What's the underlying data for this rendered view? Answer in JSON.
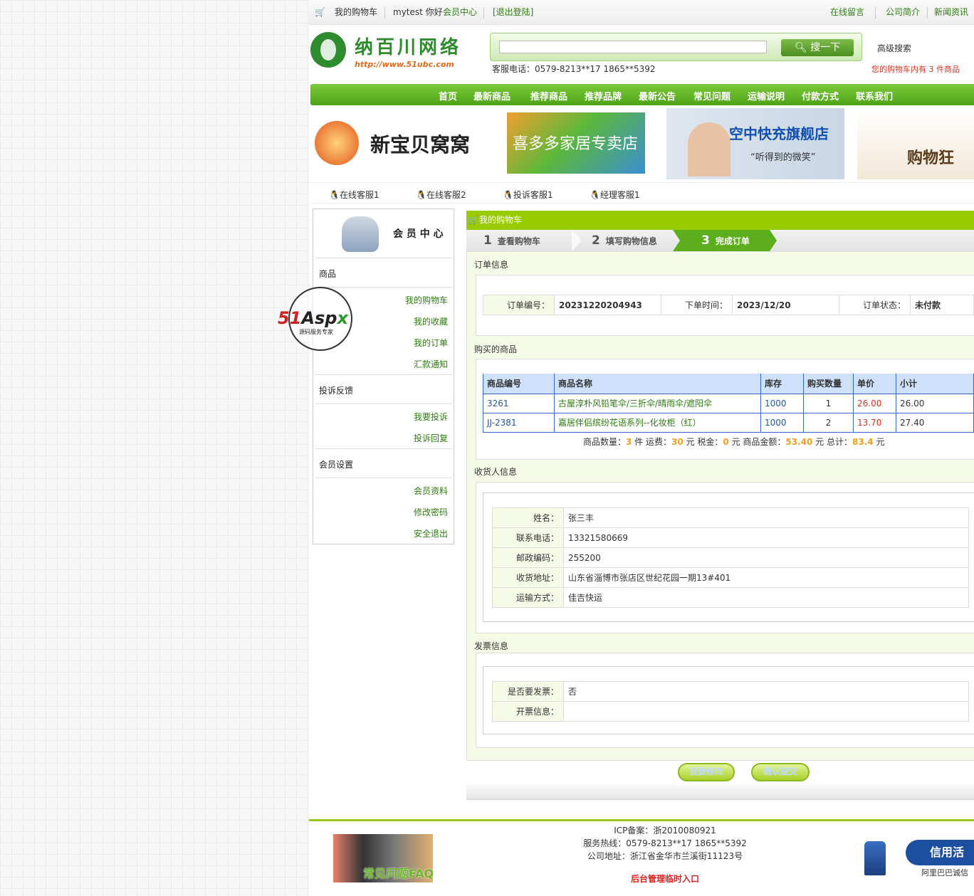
{
  "topbar": {
    "cart": "我的购物车",
    "user": "mytest 你好",
    "member": "会员中心",
    "logout": "[退出登陆]",
    "links": [
      "在线留言",
      "公司简介",
      "新闻资讯"
    ]
  },
  "header": {
    "logo_text": "纳百川网络",
    "logo_url": "http://www.51ubc.com",
    "search_placeholder": "",
    "search_button": "搜一下",
    "advanced": "高级搜索",
    "phone": "客服电话：0579-8213**17 1865**5392",
    "cart_info": "您的购物车内有 3  件商品"
  },
  "nav": [
    "首页",
    "最新商品",
    "推荐商品",
    "推荐品牌",
    "最新公告",
    "常见问题",
    "运输说明",
    "付款方式",
    "联系我们"
  ],
  "banners": [
    "新宝贝窝窝",
    "喜多多家居专卖店",
    "空中快充旗舰店",
    "“听得到的微笑”",
    "购物狂"
  ],
  "service": [
    "在线客服1",
    "在线客服2",
    "投诉客服1",
    "经理客服1"
  ],
  "sidebar": {
    "title": "会 员 中 心",
    "groups": [
      {
        "label": "商品",
        "items": [
          "我的购物车",
          "我的收藏",
          "我的订单",
          "汇款通知"
        ]
      },
      {
        "label": "投诉反馈",
        "items": [
          "我要投诉",
          "投诉回复"
        ]
      },
      {
        "label": "会员设置",
        "items": [
          "会员资料",
          "修改密码",
          "安全退出"
        ]
      }
    ]
  },
  "watermark": {
    "brand": "51Aspx",
    "tagline": "源码服务专家"
  },
  "cart": {
    "title": "我的购物车",
    "steps": [
      {
        "n": "1",
        "label": "查看购物车"
      },
      {
        "n": "2",
        "label": "填写购物信息"
      },
      {
        "n": "3",
        "label": "完成订单"
      }
    ]
  },
  "order": {
    "title": "订单信息",
    "no_label": "订单编号：",
    "no": "20231220204943",
    "time_label": "下单时间：",
    "time": "2023/12/20",
    "status_label": "订单状态：",
    "status": "未付款"
  },
  "goods": {
    "title": "购买的商品",
    "headers": [
      "商品编号",
      "商品名称",
      "库存",
      "购买数量",
      "单价",
      "小计"
    ],
    "rows": [
      [
        "3261",
        "古屋淳朴风铅笔伞/三折伞/晴雨伞/遮阳伞",
        "1000",
        "1",
        "26.00",
        "26.00"
      ],
      [
        "JJ-2381",
        "嘉居伴侣缤纷花语系列--化妆柜（红）",
        "1000",
        "2",
        "13.70",
        "27.40"
      ]
    ],
    "summary": {
      "qty_label": "商品数量：",
      "qty": "3",
      "qty_unit": "件 运费：",
      "ship": "30",
      "ship_unit": "元 税金：",
      "tax": "0",
      "tax_unit": "元 商品金额：",
      "amount": "53.40",
      "amount_unit": "元 总计：",
      "total": "83.4",
      "total_unit": "元"
    }
  },
  "receiver": {
    "title": "收货人信息",
    "rows": [
      [
        "姓名：",
        "张三丰"
      ],
      [
        "联系电话：",
        "13321580669"
      ],
      [
        "邮政编码：",
        "255200"
      ],
      [
        "收货地址：",
        "山东省淄博市张店区世纪花园一期13#401"
      ],
      [
        "运输方式：",
        "佳吉快运"
      ]
    ]
  },
  "invoice": {
    "title": "发票信息",
    "rows": [
      [
        "是否要发票：",
        "否"
      ],
      [
        "开票信息：",
        ""
      ]
    ]
  },
  "buttons": {
    "modify": "我要修改",
    "confirm": "确认提交"
  },
  "footer": {
    "icp": "ICP备案：浙2010080921",
    "hotline": "服务热线：0579-8213**17 1865**5392",
    "address": "公司地址：浙江省金华市兰溪街11123号",
    "admin": "后台管理临时入口",
    "faq": "常见问题FAQ",
    "credit": "信用活",
    "alibaba": "阿里巴巴诚信"
  }
}
